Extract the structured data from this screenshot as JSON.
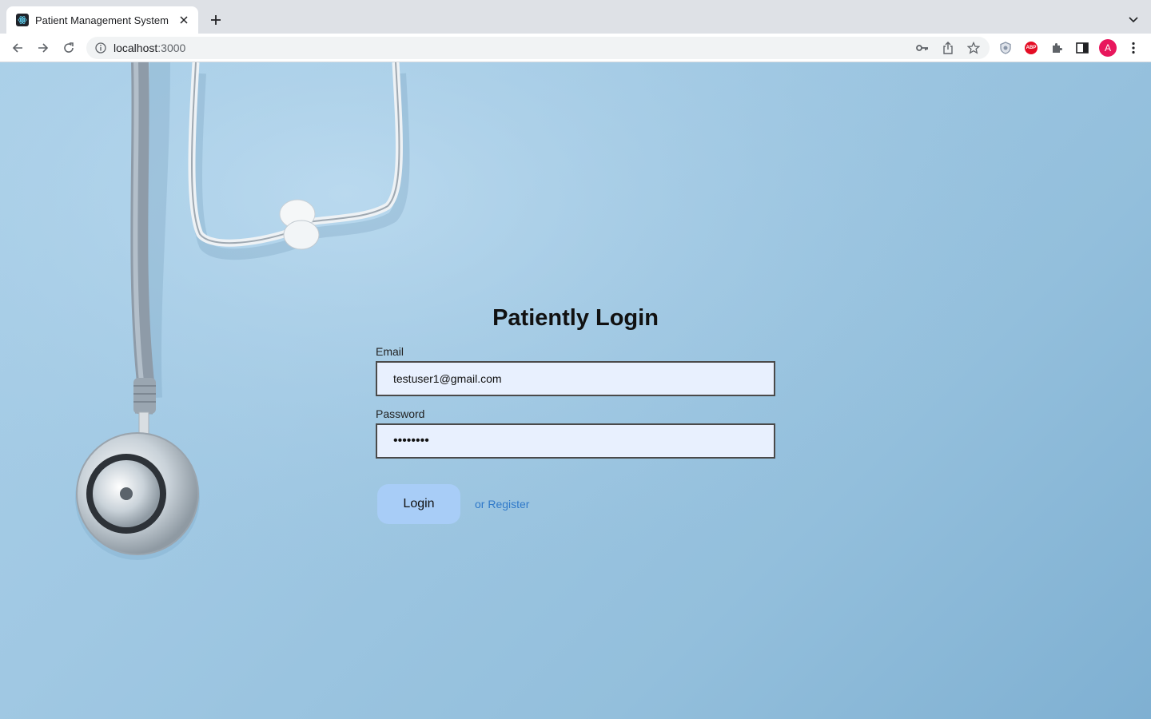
{
  "browser": {
    "tab_title": "Patient Management System",
    "url_host": "localhost",
    "url_port": ":3000",
    "avatar_letter": "A",
    "abp_label": "ABP"
  },
  "login": {
    "title": "Patiently Login",
    "email_label": "Email",
    "email_value": "testuser1@gmail.com",
    "password_label": "Password",
    "password_value": "••••••••",
    "login_button": "Login",
    "register_link": "or Register"
  },
  "colors": {
    "page_background": "#a0c8e3",
    "input_background": "#e8f0fe",
    "login_button": "#a8cdf7",
    "register_link": "#2f79c9",
    "avatar": "#e8175d"
  }
}
